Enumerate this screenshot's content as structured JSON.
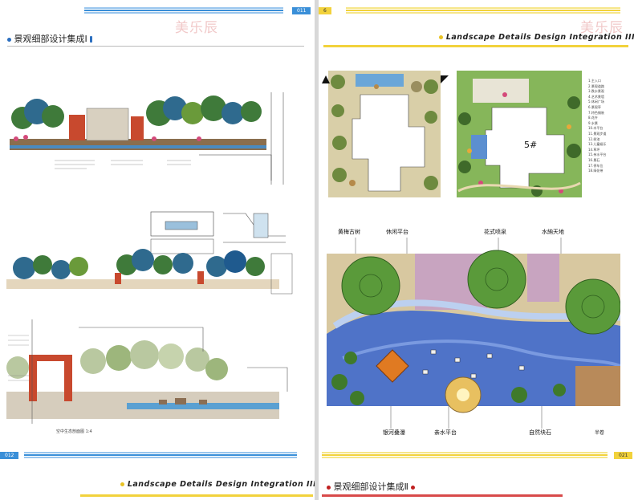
{
  "watermark": "美乐辰",
  "left_page": {
    "page_top_number": "011",
    "page_bottom_number": "012",
    "title_top": "景观细部设计集成Ⅰ",
    "title_bottom": "Landscape Details Design Integration III",
    "caption_bottom_drawing": "空中生态剖面图 1:4"
  },
  "right_page": {
    "page_top_number": "6",
    "page_bottom_number": "021",
    "title_top": "Landscape Details Design Integration III",
    "title_bottom": "景观细部设计集成Ⅱ",
    "building_label": "5#",
    "callouts_top": [
      "黄梅古树",
      "休闲平台",
      "花式喷泉",
      "水納天地"
    ],
    "callouts_bottom": [
      "银河叠瀑",
      "亲水平台",
      "自然块石"
    ],
    "corner_mark": "半卷",
    "legend_items": [
      "1.主入口",
      "2.景观道路",
      "3.跌水景观",
      "4.艺术景墙",
      "5.休闲广场",
      "6.景观亭",
      "7.特色铺装",
      "8.花卉",
      "9.水景",
      "10.木平台",
      "11.景观步道",
      "12.树池",
      "13.儿童娱乐",
      "14.草坪",
      "15.亲水平台",
      "16.景石",
      "17.停车位",
      "18.绿化带"
    ]
  },
  "colors": {
    "stripe_blue": "#3a8fd8",
    "stripe_yellow": "#f2d23c",
    "stripe_red": "#d84a4a",
    "title_dot_blue": "#2c6fc0",
    "title_dot_yellow": "#e8c224",
    "title_dot_red": "#c02020"
  }
}
